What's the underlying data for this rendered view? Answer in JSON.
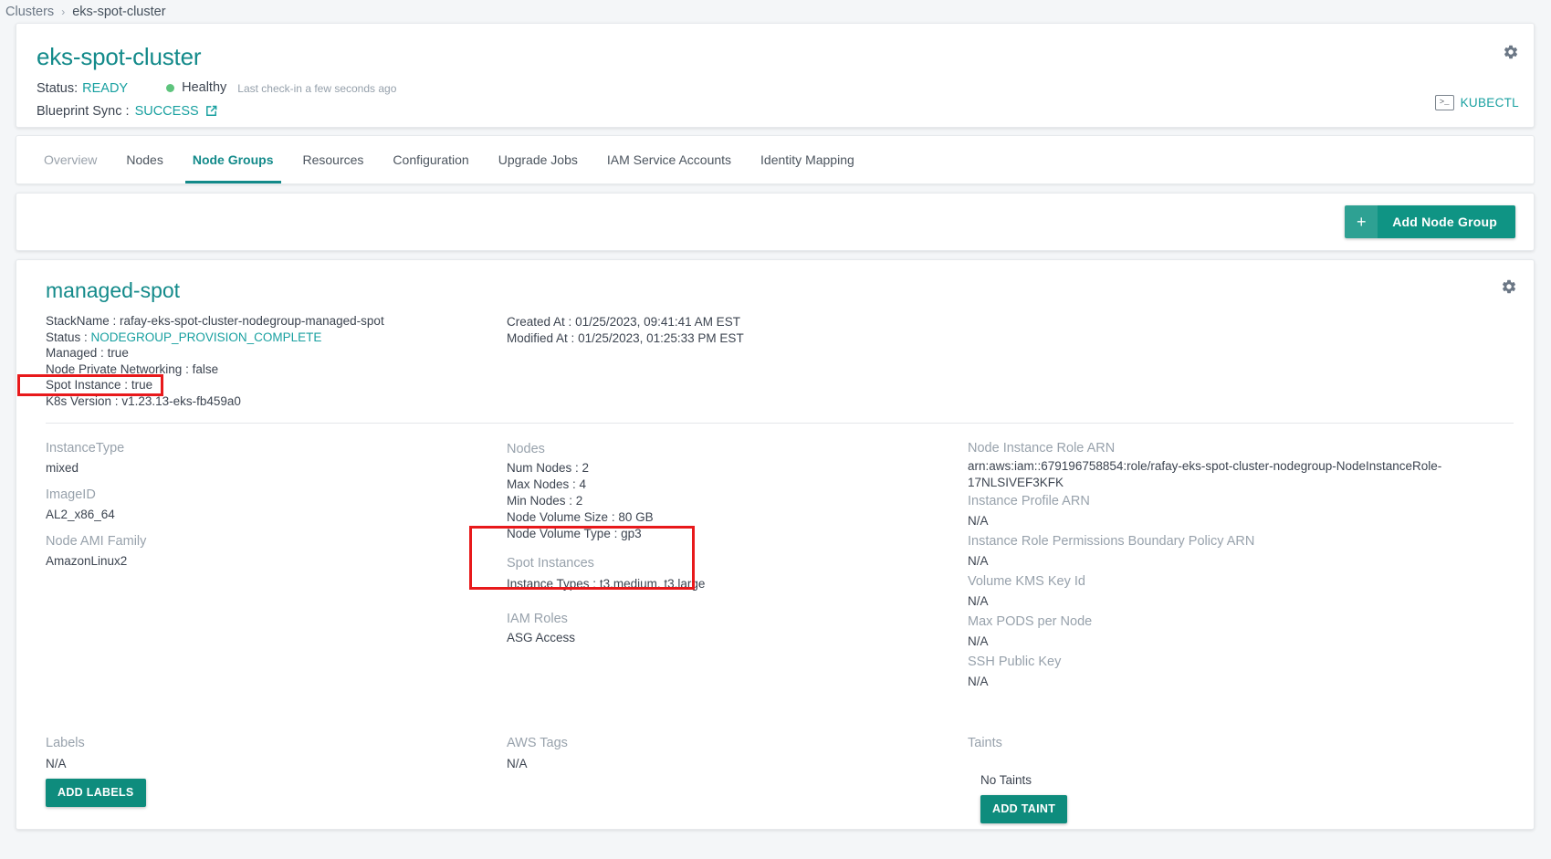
{
  "breadcrumb": {
    "root": "Clusters",
    "separator": "›",
    "current": "eks-spot-cluster"
  },
  "header": {
    "cluster_name": "eks-spot-cluster",
    "status_label": "Status:",
    "status_value": "READY",
    "health_text": "Healthy",
    "health_dot_color": "#5ec47d",
    "checkin_text": "Last check-in a few seconds ago",
    "blueprint_label": "Blueprint Sync :",
    "blueprint_value": "SUCCESS",
    "gear_icon": "gear-icon",
    "external_link_icon": "external-link-icon",
    "kubectl_label": "KUBECTL",
    "kubectl_icon": ">_"
  },
  "tabs": [
    {
      "label": "Overview",
      "active": false,
      "muted": true
    },
    {
      "label": "Nodes",
      "active": false,
      "muted": false
    },
    {
      "label": "Node Groups",
      "active": true,
      "muted": false
    },
    {
      "label": "Resources",
      "active": false,
      "muted": false
    },
    {
      "label": "Configuration",
      "active": false,
      "muted": false
    },
    {
      "label": "Upgrade Jobs",
      "active": false,
      "muted": false
    },
    {
      "label": "IAM Service Accounts",
      "active": false,
      "muted": false
    },
    {
      "label": "Identity Mapping",
      "active": false,
      "muted": false
    }
  ],
  "toolbar": {
    "add_node_group_plus": "+",
    "add_node_group_label": "Add Node Group",
    "accent_color": "#0f9484"
  },
  "nodegroup": {
    "name": "managed-spot",
    "gear_icon": "gear-icon",
    "meta_left": [
      {
        "key": "StackName :",
        "value": "rafay-eks-spot-cluster-nodegroup-managed-spot",
        "teal": false
      },
      {
        "key": "Status :",
        "value": "NODEGROUP_PROVISION_COMPLETE",
        "teal": true
      },
      {
        "key": "Managed :",
        "value": "true",
        "teal": false
      },
      {
        "key": "Node Private Networking :",
        "value": "false",
        "teal": false
      },
      {
        "key": "Spot Instance :",
        "value": "true",
        "teal": false
      },
      {
        "key": "K8s Version :",
        "value": "v1.23.13-eks-fb459a0",
        "teal": false
      }
    ],
    "meta_right": [
      {
        "key": "Created At :",
        "value": "01/25/2023, 09:41:41 AM EST"
      },
      {
        "key": "Modified At :",
        "value": "01/25/2023, 01:25:33 PM EST"
      }
    ],
    "col_left": [
      {
        "label": "InstanceType",
        "value": "mixed"
      },
      {
        "label": "ImageID",
        "value": "AL2_x86_64"
      },
      {
        "label": "Node AMI Family",
        "value": "AmazonLinux2"
      }
    ],
    "col_mid": {
      "nodes_title": "Nodes",
      "nodes_items": [
        {
          "key": "Num Nodes :",
          "value": "2"
        },
        {
          "key": "Max Nodes :",
          "value": "4"
        },
        {
          "key": "Min Nodes :",
          "value": "2"
        },
        {
          "key": "Node Volume Size :",
          "value": "80 GB"
        },
        {
          "key": "Node Volume Type :",
          "value": "gp3"
        }
      ],
      "spot_title": "Spot Instances",
      "spot_items": [
        {
          "key": "Instance Types :",
          "value": "t3.medium, t3.large"
        }
      ],
      "iam_title": "IAM Roles",
      "iam_value": "ASG Access"
    },
    "col_right": [
      {
        "label": "Node Instance Role ARN",
        "value": "arn:aws:iam::679196758854:role/rafay-eks-spot-cluster-nodegroup-NodeInstanceRole-17NLSIVEF3KFK"
      },
      {
        "label": "Instance Profile ARN",
        "value": "N/A"
      },
      {
        "label": "Instance Role Permissions Boundary Policy ARN",
        "value": "N/A"
      },
      {
        "label": "Volume KMS Key Id",
        "value": "N/A"
      },
      {
        "label": "Max PODS per Node",
        "value": "N/A"
      },
      {
        "label": "SSH Public Key",
        "value": "N/A"
      }
    ],
    "bottom": {
      "labels_title": "Labels",
      "labels_value": "N/A",
      "add_labels_button": "ADD LABELS",
      "aws_tags_title": "AWS Tags",
      "aws_tags_value": "N/A",
      "taints_title": "Taints",
      "taints_value": "No Taints",
      "add_taint_button": "ADD TAINT"
    }
  },
  "annotations": {
    "highlight_color": "#e8191b",
    "boxes": [
      {
        "name": "spot-instance-field",
        "target": "Spot Instance :  true"
      },
      {
        "name": "spot-instances-group",
        "target": "Spot Instances / Instance Types :  t3.medium, t3.large"
      }
    ]
  }
}
